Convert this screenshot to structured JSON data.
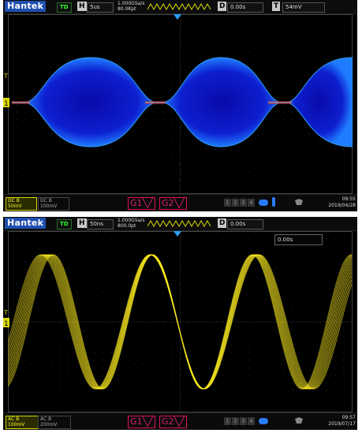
{
  "brand": "Hantek",
  "screens": [
    {
      "run_state": "TD",
      "h_label": "H",
      "timebase": "5us",
      "sample_rate": "1.000GSa/s",
      "memory": "80.0Kpt",
      "d_label": "D",
      "delay": "0.00s",
      "t_label": "T",
      "trigger_level": "54mV",
      "ch1_coupling": "DC",
      "ch1_bw": "B",
      "ch1_scale": "50mV",
      "ch2_coupling": "DC",
      "ch2_bw": "B",
      "ch2_scale": "100mV",
      "gen1": "G1",
      "gen2": "G2",
      "channel_nums": [
        "1",
        "2",
        "3",
        "4"
      ],
      "time": "09:55",
      "date": "2019/04/28",
      "waveform": "am-envelope",
      "trace_color": "#1a3cff"
    },
    {
      "run_state": "TD",
      "h_label": "H",
      "timebase": "50ns",
      "sample_rate": "1.000GSa/s",
      "memory": "800.0pt",
      "d_label": "D",
      "delay": "0.00s",
      "readout": "0.00s",
      "ch1_coupling": "AC",
      "ch1_bw": "B",
      "ch1_scale": "100mV",
      "ch2_coupling": "AC",
      "ch2_bw": "B",
      "ch2_scale": "200mV",
      "gen1": "G1",
      "gen2": "G2",
      "channel_nums": [
        "1",
        "2",
        "3",
        "4"
      ],
      "time": "09:57",
      "date": "2019/07/17",
      "waveform": "sine-jitter",
      "trace_color": "#ffee20"
    }
  ]
}
